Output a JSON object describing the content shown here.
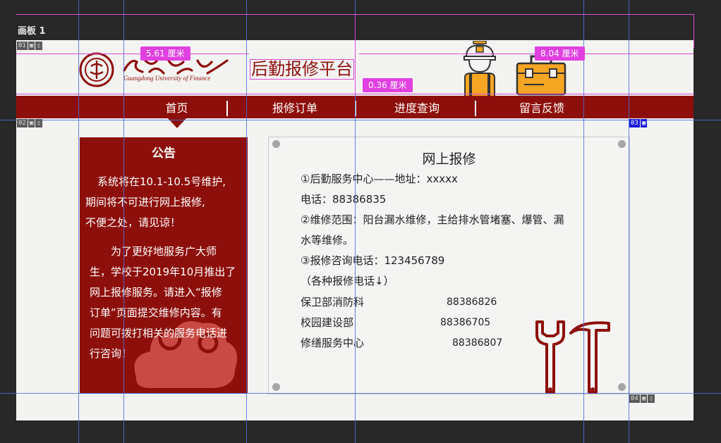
{
  "artboard": {
    "label": "画板 1"
  },
  "layer_tags": {
    "t01": "01",
    "t02": "02",
    "t03": "03",
    "t04": "04"
  },
  "measurements": {
    "m1": "5.61 厘米",
    "m2": "8.04 厘米",
    "m3": "0.36 厘米"
  },
  "header": {
    "logo_alt": "广东财经学院",
    "logo_sub": "Guangdong University of Finance",
    "platform_title": "后勤报修平台"
  },
  "nav": {
    "items": [
      "首页",
      "报修订单",
      "进度查询",
      "留言反馈"
    ]
  },
  "notice": {
    "title": "公告",
    "p1": [
      "　系统将在10.1-10.5号维护,",
      "期间将不可进行网上报修,",
      "不便之处，请见谅！"
    ],
    "p2": [
      "　　为了更好地服务广大师",
      "生，学校于2019年10月推出了",
      "网上报修服务。请进入“报修",
      "订单”页面提交维修内容。有",
      "问题可拨打相关的服务电话进",
      "行咨询！"
    ]
  },
  "card": {
    "title": "网上报修",
    "lines": [
      "①后勤服务中心——地址：xxxxx",
      "电话：88386835",
      "②维修范围：阳台漏水维修，主给排水管堵塞、爆管、漏",
      "水等维修。",
      "③报修咨询电话：123456789",
      "（各种报修电话↓）"
    ],
    "contacts": [
      {
        "name": "保卫部消防科",
        "phone": "88386826"
      },
      {
        "name": "校园建设部",
        "phone": "88386705"
      },
      {
        "name": "修缮服务中心",
        "phone": "88386807"
      }
    ]
  },
  "colors": {
    "brand_red": "#8d0f0b",
    "accent_orange": "#f5a623",
    "guide_blue": "#4a6fd8",
    "selection_magenta": "#d84ad8"
  },
  "icons": [
    "worker-icon",
    "toolbox-icon",
    "wrench-icon",
    "hammer-icon",
    "cloud-pattern-icon",
    "school-seal-icon"
  ]
}
